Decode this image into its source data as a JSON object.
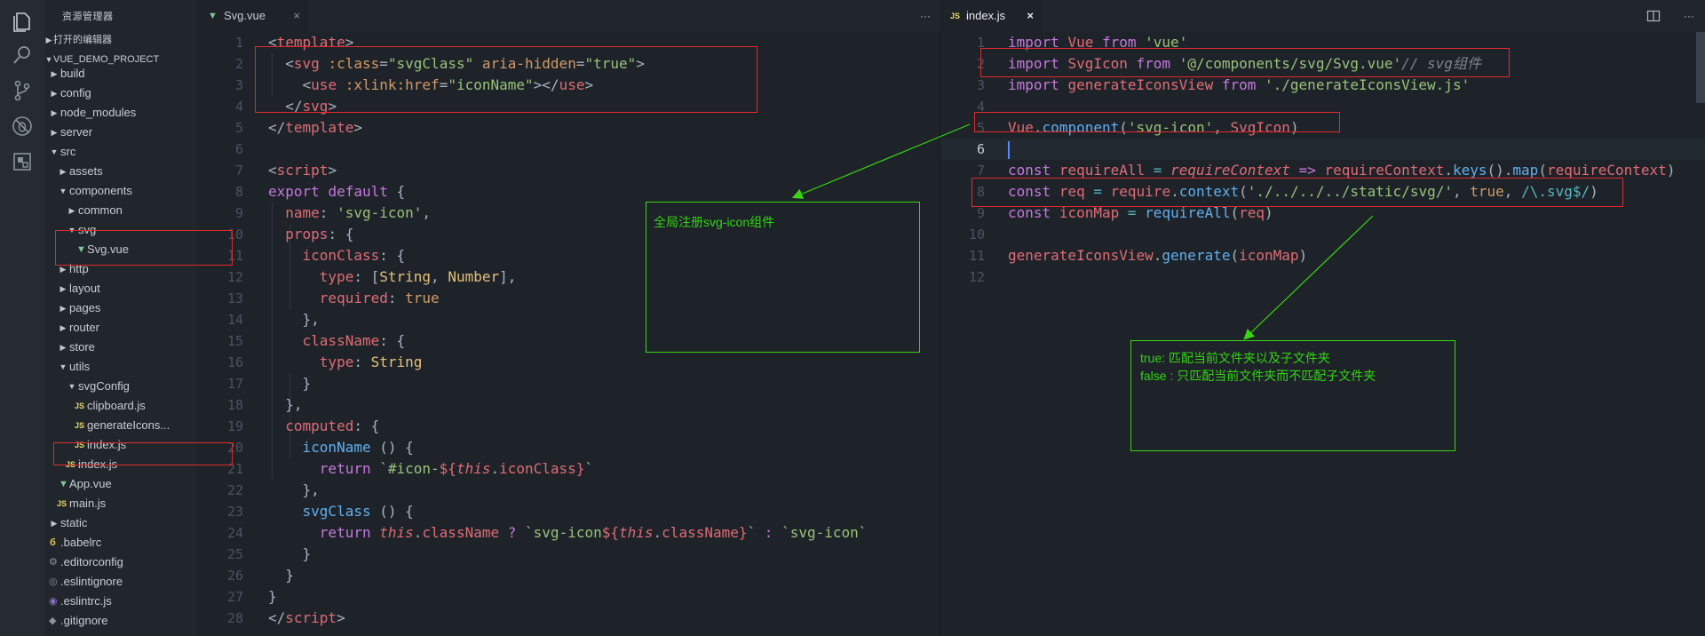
{
  "explorer": {
    "title": "资源管理器",
    "open_editors": "打开的编辑器",
    "project": "VUE_DEMO_PROJECT",
    "items": [
      {
        "label": "build",
        "kind": "folder"
      },
      {
        "label": "config",
        "kind": "folder"
      },
      {
        "label": "node_modules",
        "kind": "folder"
      },
      {
        "label": "server",
        "kind": "folder"
      },
      {
        "label": "src",
        "kind": "folder-open"
      },
      {
        "label": "assets",
        "kind": "folder"
      },
      {
        "label": "components",
        "kind": "folder-open"
      },
      {
        "label": "common",
        "kind": "folder"
      },
      {
        "label": "svg",
        "kind": "folder-open"
      },
      {
        "label": "Svg.vue",
        "kind": "vue"
      },
      {
        "label": "http",
        "kind": "folder"
      },
      {
        "label": "layout",
        "kind": "folder"
      },
      {
        "label": "pages",
        "kind": "folder"
      },
      {
        "label": "router",
        "kind": "folder"
      },
      {
        "label": "store",
        "kind": "folder"
      },
      {
        "label": "utils",
        "kind": "folder-open"
      },
      {
        "label": "svgConfig",
        "kind": "folder-open"
      },
      {
        "label": "clipboard.js",
        "kind": "js"
      },
      {
        "label": "generateIcons...",
        "kind": "js"
      },
      {
        "label": "index.js",
        "kind": "js"
      },
      {
        "label": "index.js",
        "kind": "js"
      },
      {
        "label": "App.vue",
        "kind": "vue"
      },
      {
        "label": "main.js",
        "kind": "js"
      },
      {
        "label": "static",
        "kind": "folder"
      },
      {
        "label": ".babelrc",
        "kind": "babel"
      },
      {
        "label": ".editorconfig",
        "kind": "config"
      },
      {
        "label": ".eslintignore",
        "kind": "config"
      },
      {
        "label": ".eslintrc.js",
        "kind": "eslint"
      },
      {
        "label": ".gitignore",
        "kind": "config"
      }
    ]
  },
  "tabs": {
    "left": {
      "label": "Svg.vue",
      "icon": "vue-file-icon",
      "close": "×",
      "more": "···"
    },
    "right": {
      "label": "index.js",
      "icon_text": "JS",
      "close": "×",
      "more": "···"
    }
  },
  "left_lines": [
    "1",
    "2",
    "3",
    "4",
    "5",
    "6",
    "7",
    "8",
    "9",
    "10",
    "11",
    "12",
    "13",
    "14",
    "15",
    "16",
    "17",
    "18",
    "19",
    "20",
    "21",
    "22",
    "23",
    "24",
    "25",
    "26",
    "27",
    "28"
  ],
  "right_lines": [
    "1",
    "2",
    "3",
    "4",
    "5",
    "6",
    "7",
    "8",
    "9",
    "10",
    "11",
    "12"
  ],
  "annotations": {
    "note1": "全局注册svg-icon组件",
    "note2_line1": "true: 匹配当前文件夹以及子文件夹",
    "note2_line2": "false : 只匹配当前文件夹而不匹配子文件夹"
  },
  "colors": {
    "annotation_red": "#e02a2a",
    "annotation_green": "#3bd313",
    "background": "#1e2329"
  }
}
